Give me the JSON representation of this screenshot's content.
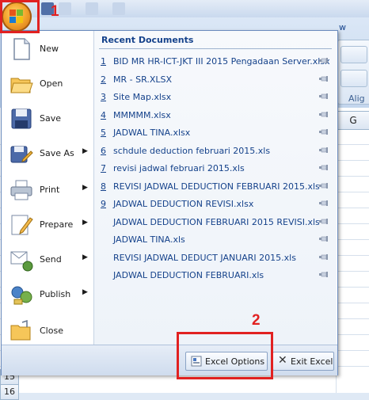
{
  "ribbon": {
    "tab_partial": "w",
    "column_header": "G",
    "group_label_partial": "Alig",
    "row_numbers": [
      "15",
      "16"
    ]
  },
  "office_button": {
    "logo": "office-logo-icon"
  },
  "callouts": {
    "first": "1",
    "second": "2"
  },
  "menu": {
    "left_items": [
      {
        "label": "New",
        "icon": "new-document-icon",
        "has_submenu": false
      },
      {
        "label": "Open",
        "icon": "open-folder-icon",
        "has_submenu": false
      },
      {
        "label": "Save",
        "icon": "floppy-disk-icon",
        "has_submenu": false
      },
      {
        "label": "Save As",
        "icon": "save-as-icon",
        "has_submenu": true
      },
      {
        "label": "Print",
        "icon": "printer-icon",
        "has_submenu": true
      },
      {
        "label": "Prepare",
        "icon": "prepare-pencil-icon",
        "has_submenu": true
      },
      {
        "label": "Send",
        "icon": "send-mail-icon",
        "has_submenu": true
      },
      {
        "label": "Publish",
        "icon": "publish-icon",
        "has_submenu": true
      },
      {
        "label": "Close",
        "icon": "close-folder-icon",
        "has_submenu": false
      }
    ],
    "recent_title": "Recent Documents",
    "recent_documents": [
      {
        "num": "1",
        "name": "BID MR HR-ICT-JKT III 2015 Pengadaan Server.xlsx"
      },
      {
        "num": "2",
        "name": "MR - SR.XLSX"
      },
      {
        "num": "3",
        "name": "Site Map.xlsx"
      },
      {
        "num": "4",
        "name": "MMMMM.xlsx"
      },
      {
        "num": "5",
        "name": "JADWAL TINA.xlsx"
      },
      {
        "num": "6",
        "name": "schdule deduction februari 2015.xls"
      },
      {
        "num": "7",
        "name": "revisi jadwal februari 2015.xls"
      },
      {
        "num": "8",
        "name": "REVISI JADWAL DEDUCTION FEBRUARI 2015.xls"
      },
      {
        "num": "9",
        "name": "JADWAL DEDUCTION REVISI.xlsx"
      },
      {
        "num": "",
        "name": "JADWAL DEDUCTION FEBRUARI 2015 REVISI.xls"
      },
      {
        "num": "",
        "name": "JADWAL TINA.xls"
      },
      {
        "num": "",
        "name": "REVISI JADWAL DEDUCT JANUARI 2015.xls"
      },
      {
        "num": "",
        "name": "JADWAL DEDUCTION FEBRUARI.xls"
      }
    ],
    "excel_options_label": "Excel Options",
    "exit_excel_label": "Exit Excel"
  }
}
